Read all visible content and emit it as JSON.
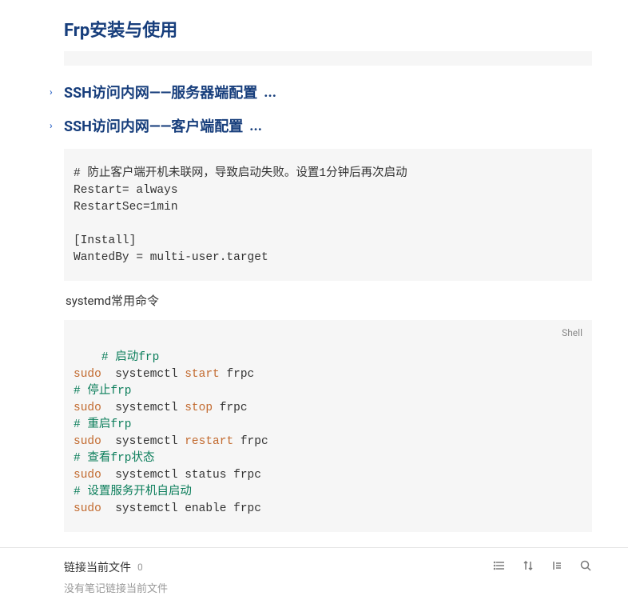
{
  "page_title": "Frp安装与使用",
  "sections": {
    "server": {
      "heading": "SSH访问内网——服务器端配置",
      "dots": "..."
    },
    "client": {
      "heading": "SSH访问内网——客户端配置",
      "dots": "..."
    }
  },
  "code1": {
    "l1": "# 防止客户端开机未联网，导致启动失败。设置1分钟后再次启动",
    "l2": "Restart= always",
    "l3": "RestartSec=1min",
    "l4": "",
    "l5": "[Install]",
    "l6": "WantedBy = multi-user.target"
  },
  "body_text": "systemd常用命令",
  "code2": {
    "lang": "Shell",
    "lines": [
      {
        "comment": "# 启动frp"
      },
      {
        "key": "sudo ",
        "cmd1": " systemctl ",
        "key2": "start",
        "cmd2": " frpc"
      },
      {
        "comment": "# 停止frp"
      },
      {
        "key": "sudo ",
        "cmd1": " systemctl ",
        "key2": "stop",
        "cmd2": " frpc"
      },
      {
        "comment": "# 重启frp"
      },
      {
        "key": "sudo ",
        "cmd1": " systemctl ",
        "key2": "restart",
        "cmd2": " frpc"
      },
      {
        "comment": "# 查看frp状态"
      },
      {
        "key": "sudo ",
        "cmd1": " systemctl status frpc"
      },
      {
        "comment": "# 设置服务开机自启动"
      },
      {
        "key": "sudo ",
        "cmd1": " systemctl enable frpc"
      }
    ]
  },
  "footer": {
    "title": "链接当前文件",
    "count": "0",
    "subtitle": "没有笔记链接当前文件"
  }
}
